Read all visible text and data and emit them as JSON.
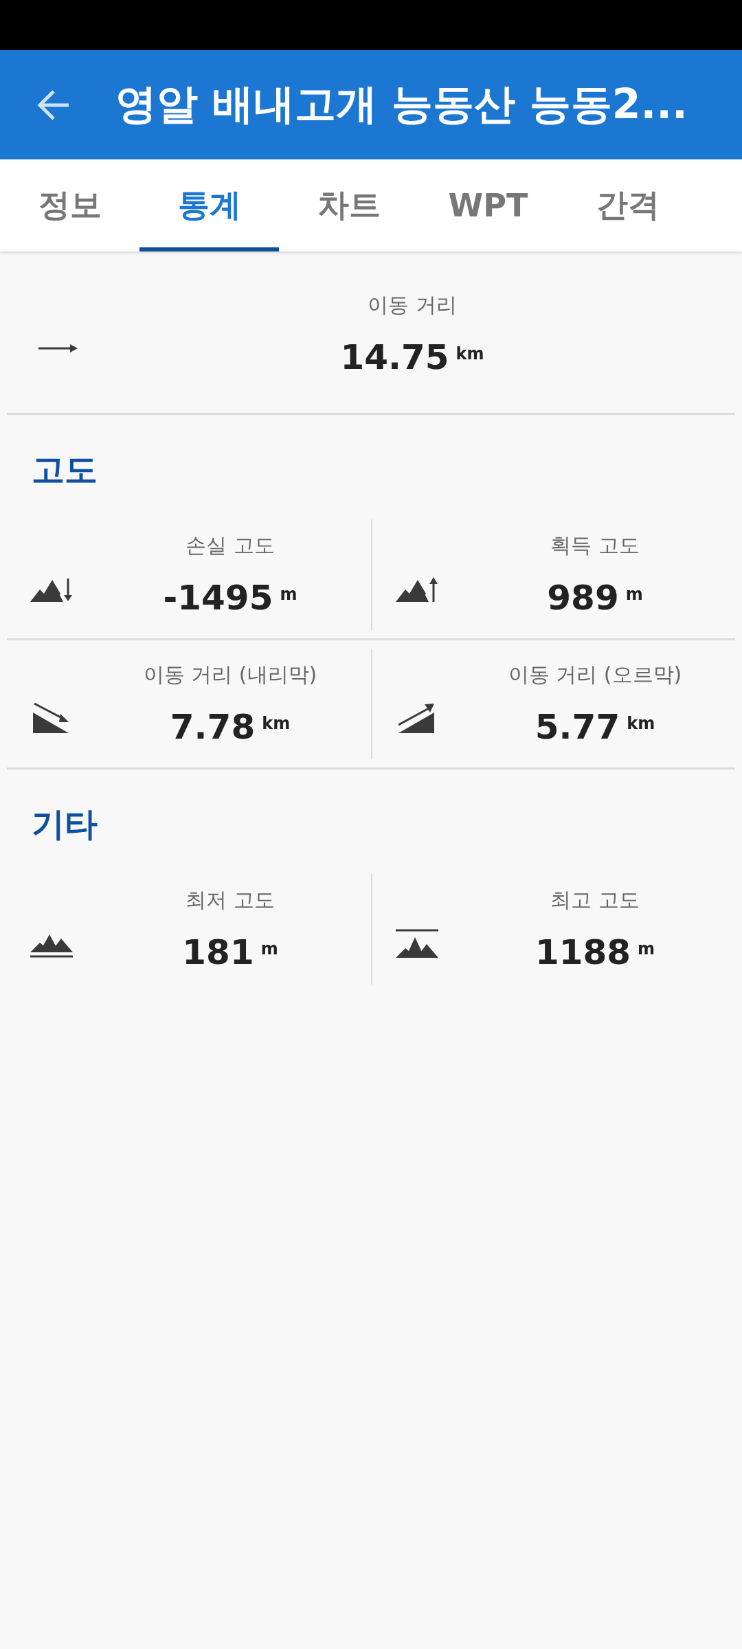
{
  "app_bar": {
    "title": "영알 배내고개 능동산 능동2..."
  },
  "tabs": [
    {
      "label": "정보",
      "selected": false
    },
    {
      "label": "통계",
      "selected": true
    },
    {
      "label": "차트",
      "selected": false
    },
    {
      "label": "WPT",
      "selected": false
    },
    {
      "label": "간격",
      "selected": false
    }
  ],
  "summary": {
    "kind": "distance",
    "label": "이동 거리",
    "value": "14.75",
    "unit": "km"
  },
  "sections": [
    {
      "title": "고도",
      "stats": [
        {
          "kind": "descent",
          "label": "손실 고도",
          "value": "-1495",
          "unit": "m"
        },
        {
          "kind": "ascent",
          "label": "획득 고도",
          "value": "989",
          "unit": "m"
        },
        {
          "kind": "downhill",
          "label": "이동 거리 (내리막)",
          "value": "7.78",
          "unit": "km"
        },
        {
          "kind": "uphill",
          "label": "이동 거리 (오르막)",
          "value": "5.77",
          "unit": "km"
        }
      ]
    },
    {
      "title": "기타",
      "stats": [
        {
          "kind": "min_altitude",
          "label": "최저 고도",
          "value": "181",
          "unit": "m"
        },
        {
          "kind": "max_altitude",
          "label": "최고 고도",
          "value": "1188",
          "unit": "m"
        }
      ]
    }
  ]
}
